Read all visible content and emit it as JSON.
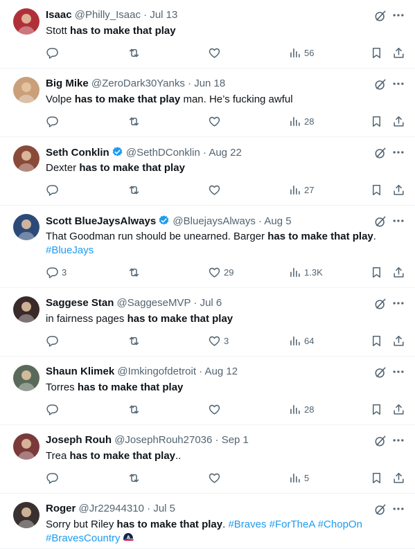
{
  "tweets": [
    {
      "name": "Isaac",
      "handle": "@Philly_Isaac",
      "date": "Jul 13",
      "verified": false,
      "segments": [
        {
          "t": "Stott "
        },
        {
          "t": "has to make that play",
          "b": true
        }
      ],
      "replies": "",
      "likes": "",
      "views": "56",
      "avatar_color": "#b0303a"
    },
    {
      "name": "Big Mike",
      "handle": "@ZeroDark30Yanks",
      "date": "Jun 18",
      "verified": false,
      "segments": [
        {
          "t": "Volpe "
        },
        {
          "t": "has to make that play",
          "b": true
        },
        {
          "t": " man. He’s fucking awful"
        }
      ],
      "replies": "",
      "likes": "",
      "views": "28",
      "avatar_color": "#c9a07a"
    },
    {
      "name": "Seth Conklin",
      "handle": "@SethDConklin",
      "date": "Aug 22",
      "verified": true,
      "segments": [
        {
          "t": "Dexter "
        },
        {
          "t": "has to make that play",
          "b": true
        }
      ],
      "replies": "",
      "likes": "",
      "views": "27",
      "avatar_color": "#8a4a3a"
    },
    {
      "name": "Scott BlueJaysAlways",
      "handle": "@BluejaysAlways",
      "date": "Aug 5",
      "verified": true,
      "segments": [
        {
          "t": "That Goodman run should be unearned. Barger "
        },
        {
          "t": "has to make that play",
          "b": true
        },
        {
          "t": "."
        },
        {
          "t": "#BlueJays",
          "tag": true,
          "br": true
        }
      ],
      "replies": "3",
      "likes": "29",
      "views": "1.3K",
      "avatar_color": "#2c4a78"
    },
    {
      "name": "Saggese Stan",
      "handle": "@SaggeseMVP",
      "date": "Jul 6",
      "verified": false,
      "segments": [
        {
          "t": "in fairness pages "
        },
        {
          "t": "has to make that play",
          "b": true
        }
      ],
      "replies": "",
      "likes": "3",
      "views": "64",
      "avatar_color": "#3a2a2a"
    },
    {
      "name": "Shaun Klimek",
      "handle": "@Imkingofdetroit",
      "date": "Aug 12",
      "verified": false,
      "segments": [
        {
          "t": "Torres "
        },
        {
          "t": "has to make that play",
          "b": true
        }
      ],
      "replies": "",
      "likes": "",
      "views": "28",
      "avatar_color": "#5a6a5a"
    },
    {
      "name": "Joseph Rouh",
      "handle": "@JosephRouh27036",
      "date": "Sep 1",
      "verified": false,
      "segments": [
        {
          "t": "Trea "
        },
        {
          "t": "has to make that play",
          "b": true
        },
        {
          "t": ".."
        }
      ],
      "replies": "",
      "likes": "",
      "views": "5",
      "avatar_color": "#7a3a3a"
    },
    {
      "name": "Roger",
      "handle": "@Jr22944310",
      "date": "Jul 5",
      "verified": false,
      "segments": [
        {
          "t": "Sorry but Riley "
        },
        {
          "t": "has to make that play",
          "b": true
        },
        {
          "t": ". "
        },
        {
          "t": "#Braves",
          "tag": true
        },
        {
          "t": " "
        },
        {
          "t": "#ForTheA",
          "tag": true
        },
        {
          "t": " "
        },
        {
          "t": "#ChopOn",
          "tag": true
        },
        {
          "t": "#BravesCountry",
          "tag": true,
          "br": true
        }
      ],
      "replies": "",
      "likes": "",
      "views": "",
      "avatar_color": "#3a3030"
    }
  ],
  "icons": {
    "reply": "reply-icon",
    "retweet": "retweet-icon",
    "like": "like-icon",
    "views": "views-icon",
    "bookmark": "bookmark-icon",
    "share": "share-icon",
    "grok": "grok-icon",
    "more": "more-icon",
    "verified": "verified-badge-icon",
    "braves_emoji": "braves-cap-emoji"
  },
  "colors": {
    "link": "#1d9bf0",
    "muted": "#536471",
    "text": "#0f1419",
    "verified": "#1d9bf0"
  }
}
